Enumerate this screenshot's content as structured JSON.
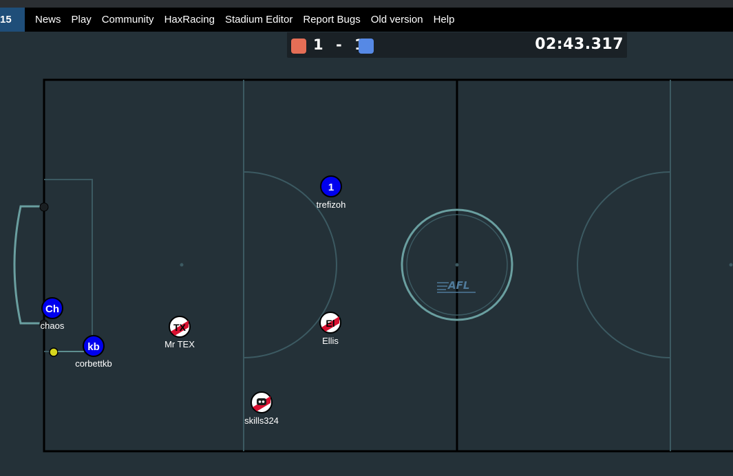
{
  "nav": {
    "badge": "15",
    "items": [
      "News",
      "Play",
      "Community",
      "HaxRacing",
      "Stadium Editor",
      "Report Bugs",
      "Old version",
      "Help"
    ]
  },
  "scoreboard": {
    "red_score": "1",
    "separator": "-",
    "blue_score": "1",
    "timer": "02:43.317"
  },
  "colors": {
    "red_team": "#e56e56",
    "blue_team": "#5689e5",
    "field_bg": "#243138",
    "line": "#000000"
  },
  "field": {
    "center_logo": "AFL"
  },
  "players": [
    {
      "avatar": "1",
      "name": "trefizoh",
      "team": "blue"
    },
    {
      "avatar": "Ch",
      "name": "chaos",
      "team": "blue"
    },
    {
      "avatar": "kb",
      "name": "corbettkb",
      "team": "blue"
    },
    {
      "avatar": "TX",
      "name": "Mr TEX",
      "team": "red"
    },
    {
      "avatar": "El",
      "name": "Ellis",
      "team": "red"
    },
    {
      "avatar": "",
      "name": "skills324",
      "team": "red"
    }
  ]
}
